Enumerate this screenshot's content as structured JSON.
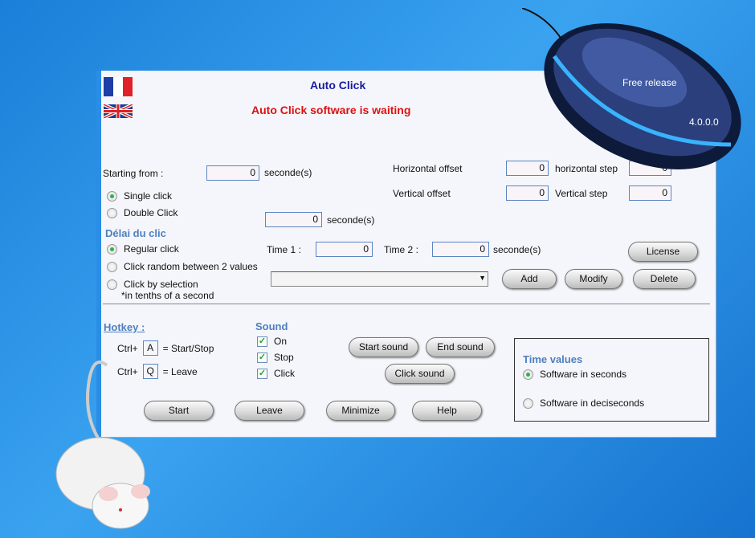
{
  "title": "Auto Click",
  "status": "Auto Click software is waiting",
  "mouse_image": {
    "free_release": "Free release",
    "version": "4.0.0.0"
  },
  "starting_from": {
    "label": "Starting from :",
    "value": "0",
    "unit": "seconde(s)"
  },
  "click_type": {
    "options": [
      "Single click",
      "Double Click"
    ],
    "selected": 0
  },
  "double_click_delay": {
    "value": "0",
    "unit": "seconde(s)"
  },
  "offsets": {
    "horizontal_offset_label": "Horizontal offset",
    "horizontal_offset": "0",
    "horizontal_step_label": "horizontal step",
    "horizontal_step": "0",
    "vertical_offset_label": "Vertical offset",
    "vertical_offset": "0",
    "vertical_step_label": "Vertical step",
    "vertical_step": "0"
  },
  "delay": {
    "heading": "Délai du clic",
    "options": [
      "Regular click",
      "Click random between 2 values",
      "Click by selection"
    ],
    "note": "*in tenths of a second",
    "selected": 0,
    "time1_label": "Time 1 :",
    "time1": "0",
    "time2_label": "Time 2 :",
    "time2": "0",
    "unit": "seconde(s)",
    "selection_value": ""
  },
  "buttons": {
    "license": "License",
    "add": "Add",
    "modify": "Modify",
    "delete": "Delete",
    "start_sound": "Start sound",
    "end_sound": "End sound",
    "click_sound": "Click sound",
    "start": "Start",
    "leave": "Leave",
    "minimize": "Minimize",
    "help": "Help"
  },
  "hotkey": {
    "heading": "Hotkey :",
    "ctrl": "Ctrl+",
    "start_key": "A",
    "start_label": "= Start/Stop",
    "leave_key": "Q",
    "leave_label": "= Leave"
  },
  "sound": {
    "heading": "Sound",
    "options": [
      {
        "label": "On",
        "checked": true
      },
      {
        "label": "Stop",
        "checked": true
      },
      {
        "label": "Click",
        "checked": true
      }
    ]
  },
  "time_values": {
    "heading": "Time values",
    "options": [
      "Software in seconds",
      "Software in deciseconds"
    ],
    "selected": 0
  },
  "colors": {
    "title": "#1a1aa0",
    "status": "#e01010",
    "accent": "#4f7fc0"
  }
}
